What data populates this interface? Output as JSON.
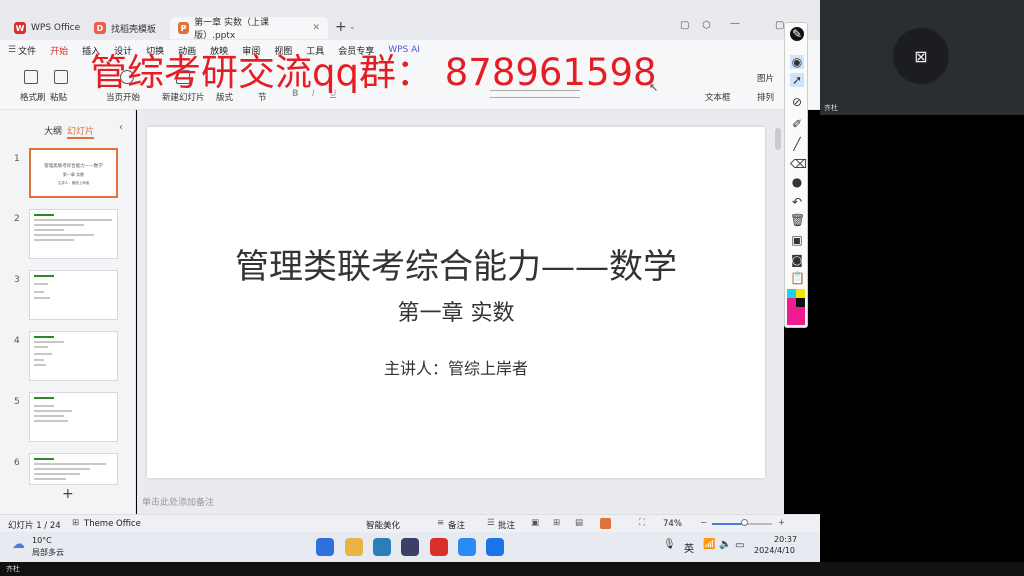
{
  "tabs": [
    {
      "label": "WPS Office",
      "icon": "wps-logo-icon"
    },
    {
      "label": "找稻壳模板",
      "icon": "docer-icon"
    },
    {
      "label": "第一章 实数（上课版）.pptx",
      "icon": "pptx-icon"
    }
  ],
  "menu": [
    "文件",
    "开始",
    "插入",
    "设计",
    "切换",
    "动画",
    "放映",
    "审阅",
    "视图",
    "工具",
    "会员专享",
    "WPS AI"
  ],
  "ribbon": {
    "format_painter": "格式刷",
    "paste": "粘贴",
    "from_current": "当页开始",
    "new_slide": "新建幻灯片",
    "layout": "版式",
    "section": "节",
    "textbox": "文本框",
    "arrange": "排列",
    "picture": "图片",
    "bold": "B",
    "italic": "I",
    "underline": "U"
  },
  "left_panel": {
    "outline_tab": "大纲",
    "slides_tab": "幻灯片",
    "add_button": "+",
    "thumbs": [
      {
        "num": "1",
        "title": "管理类联考综合能力——数学",
        "sub": "第一章 实数",
        "pres": "主讲人：管综上岸者"
      },
      {
        "num": "2"
      },
      {
        "num": "3"
      },
      {
        "num": "4"
      },
      {
        "num": "5"
      },
      {
        "num": "6"
      }
    ]
  },
  "slide": {
    "title": "管理类联考综合能力——数学",
    "subtitle": "第一章  实数",
    "presenter": "主讲人：管综上岸者"
  },
  "notes_placeholder": "单击此处添加备注",
  "status": {
    "slide_count": "幻灯片 1 / 24",
    "theme": "Theme Office",
    "beautify": "智能美化",
    "notes": "备注",
    "comments": "批注",
    "zoom": "74%"
  },
  "weather": {
    "temp": "10°C",
    "desc": "局部多云"
  },
  "clock": {
    "time": "20:37",
    "date": "2024/4/10"
  },
  "ime": "英",
  "overlay_text": "管综考研交流qq群：  878961598",
  "video": {
    "name": "齐杜"
  },
  "bottom_label": "齐杜",
  "colors": {
    "accent": "#e0733a",
    "overlay": "#e31e24",
    "wps_red": "#d9302c"
  }
}
